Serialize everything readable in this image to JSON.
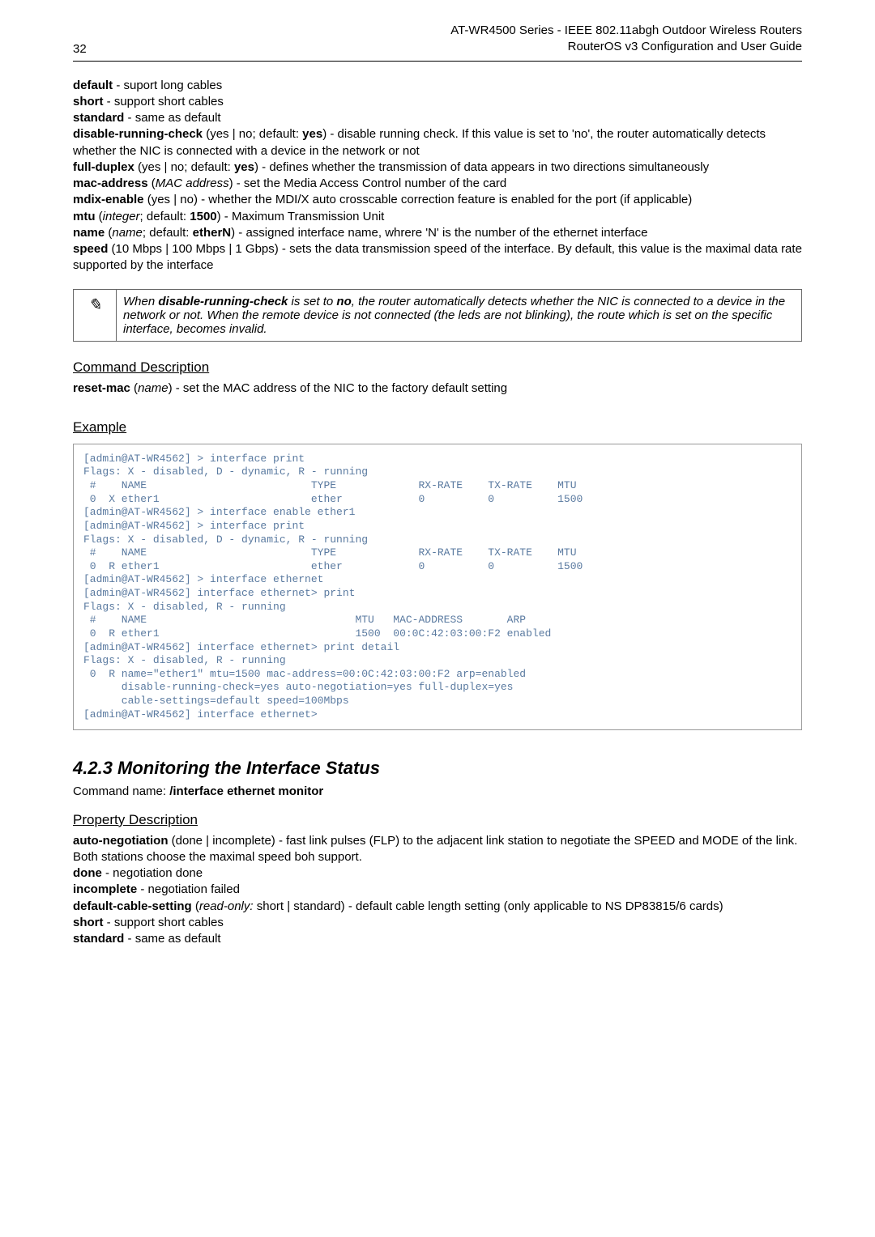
{
  "header": {
    "page_number": "32",
    "title_line1": "AT-WR4500 Series - IEEE 802.11abgh Outdoor Wireless Routers",
    "title_line2": "RouterOS v3 Configuration and User Guide"
  },
  "props1": {
    "default_label": "default",
    "default_text": " - suport long cables",
    "short_label": "short",
    "short_text": " - support short cables",
    "standard_label": "standard",
    "standard_text": " - same as default",
    "drc_label": "disable-running-check",
    "drc_paren_pre": " (yes | no; default: ",
    "drc_default": "yes",
    "drc_text": ") - disable running check. If this value is set to 'no', the router automatically detects whether the NIC is connected with a device in the network or not",
    "fd_label": "full-duplex",
    "fd_paren_pre": " (yes | no; default: ",
    "fd_default": "yes",
    "fd_text": ") - defines whether the transmission of data appears in two directions simultaneously",
    "mac_label": "mac-address",
    "mac_paren_pre": " (",
    "mac_type": "MAC address",
    "mac_text": ") - set the Media Access Control number of the card",
    "mdix_label": "mdix-enable",
    "mdix_text": " (yes | no) - whether the MDI/X auto crosscable correction feature is enabled for the port (if applicable)",
    "mtu_label": "mtu",
    "mtu_paren_pre": " (",
    "mtu_type": "integer",
    "mtu_mid": "; default: ",
    "mtu_default": "1500",
    "mtu_text": ") - Maximum Transmission Unit",
    "name_label": "name",
    "name_paren_pre": " (",
    "name_type": "name",
    "name_mid": "; default: ",
    "name_default": "etherN",
    "name_text": ") - assigned interface name, whrere 'N' is the number of the ethernet interface",
    "speed_label": "speed",
    "speed_text": " (10 Mbps | 100 Mbps | 1 Gbps) - sets the data transmission speed of the interface. By default, this value is the maximal data rate supported by the interface"
  },
  "note": {
    "icon": "✎",
    "pre": "When ",
    "b1": "disable-running-check",
    "mid1": " is set to ",
    "b2": "no",
    "text": ", the router automatically detects whether the NIC is connected to a device in the network or not. When the remote device is not connected (the leds are not blinking), the route which is set on the specific interface, becomes invalid."
  },
  "cmd_desc": {
    "heading": "Command Description",
    "label": "reset-mac",
    "paren_pre": " (",
    "type": "name",
    "text": ") - set the MAC address of the NIC to the factory default setting"
  },
  "example": {
    "heading": "Example",
    "code": "[admin@AT-WR4562] > interface print\nFlags: X - disabled, D - dynamic, R - running\n #    NAME                          TYPE             RX-RATE    TX-RATE    MTU\n 0  X ether1                        ether            0          0          1500\n[admin@AT-WR4562] > interface enable ether1\n[admin@AT-WR4562] > interface print\nFlags: X - disabled, D - dynamic, R - running\n #    NAME                          TYPE             RX-RATE    TX-RATE    MTU\n 0  R ether1                        ether            0          0          1500\n[admin@AT-WR4562] > interface ethernet\n[admin@AT-WR4562] interface ethernet> print\nFlags: X - disabled, R - running\n #    NAME                                 MTU   MAC-ADDRESS       ARP\n 0  R ether1                               1500  00:0C:42:03:00:F2 enabled\n[admin@AT-WR4562] interface ethernet> print detail\nFlags: X - disabled, R - running\n 0  R name=\"ether1\" mtu=1500 mac-address=00:0C:42:03:00:F2 arp=enabled\n      disable-running-check=yes auto-negotiation=yes full-duplex=yes\n      cable-settings=default speed=100Mbps\n[admin@AT-WR4562] interface ethernet>"
  },
  "section423": {
    "title": "4.2.3 Monitoring the Interface Status",
    "cmd_pre": "Command name: ",
    "cmd": "/interface ethernet monitor",
    "pd_heading": "Property Description",
    "an_label": "auto-negotiation",
    "an_text": " (done | incomplete) - fast link pulses (FLP) to the adjacent link station to negotiate the SPEED and MODE of the link. Both stations choose the maximal speed boh support.",
    "done_label": "done",
    "done_text": " - negotiation done",
    "inc_label": "incomplete",
    "inc_text": " - negotiation failed",
    "dcs_label": "default-cable-setting",
    "dcs_paren_pre": " (",
    "dcs_type": "read-only:",
    "dcs_text": " short | standard) - default cable length setting (only applicable to NS DP83815/6 cards)",
    "short2_label": "short",
    "short2_text": " - support short cables",
    "std2_label": "standard",
    "std2_text": " - same as default"
  }
}
